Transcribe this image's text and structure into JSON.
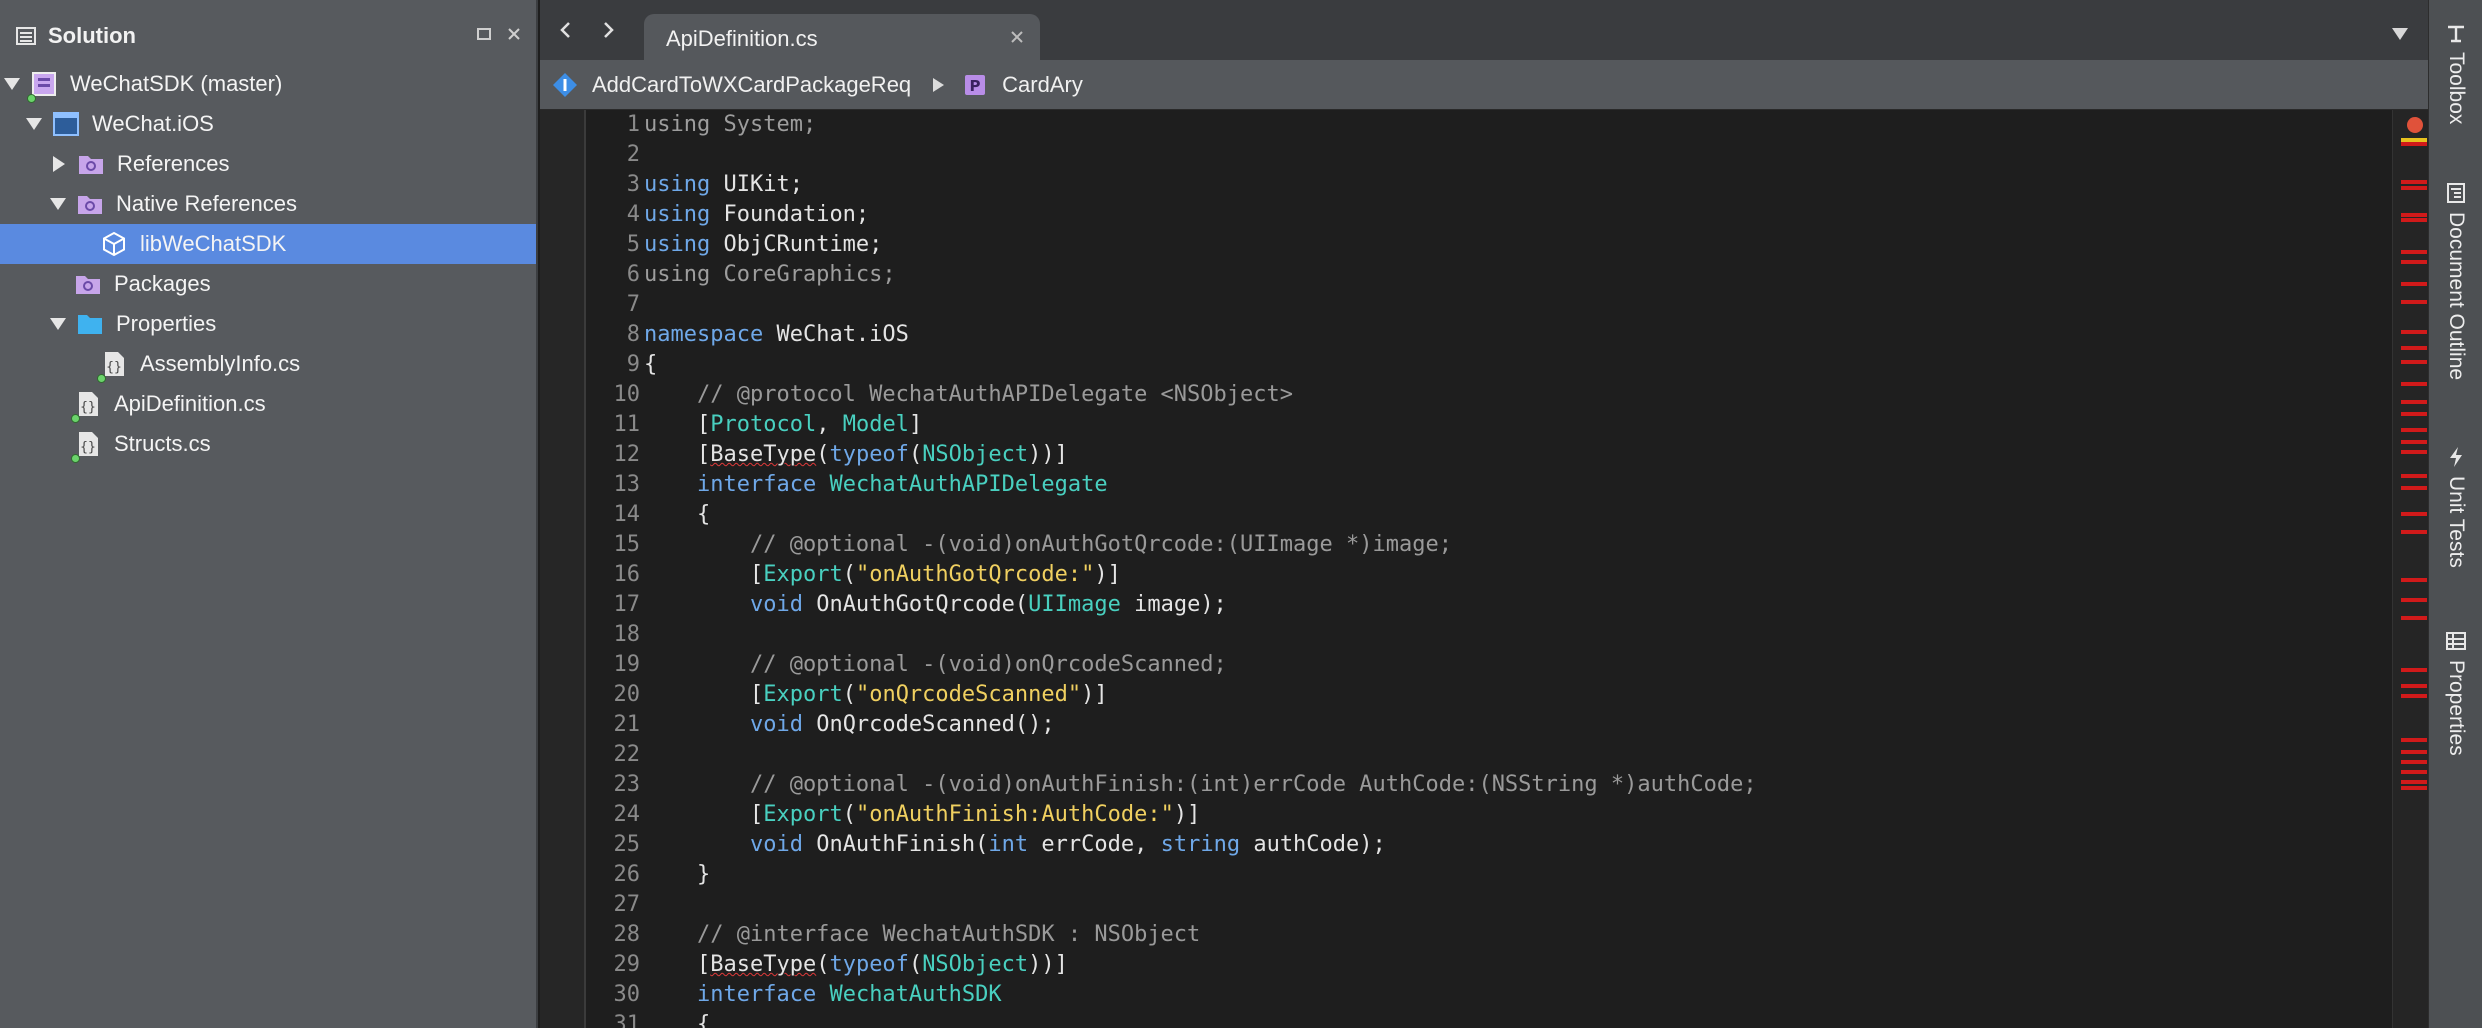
{
  "solution_pad": {
    "title": "Solution",
    "items": [
      {
        "label": "WeChatSDK (master)",
        "icon": "solution-icon"
      },
      {
        "label": "WeChat.iOS",
        "icon": "project-icon"
      },
      {
        "label": "References",
        "icon": "references-folder-icon"
      },
      {
        "label": "Native References",
        "icon": "native-references-folder-icon"
      },
      {
        "label": "libWeChatSDK",
        "icon": "library-icon"
      },
      {
        "label": "Packages",
        "icon": "packages-folder-icon"
      },
      {
        "label": "Properties",
        "icon": "folder-icon"
      },
      {
        "label": "AssemblyInfo.cs",
        "icon": "csharp-file-icon"
      },
      {
        "label": "ApiDefinition.cs",
        "icon": "csharp-file-icon"
      },
      {
        "label": "Structs.cs",
        "icon": "csharp-file-icon"
      }
    ]
  },
  "editor": {
    "active_tab": "ApiDefinition.cs",
    "breadcrumb": {
      "class_name": "AddCardToWXCardPackageReq",
      "member_name": "CardAry"
    }
  },
  "code": [
    {
      "n": "1",
      "text": "using System;"
    },
    {
      "n": "2",
      "text": ""
    },
    {
      "n": "3",
      "text": "using UIKit;"
    },
    {
      "n": "4",
      "text": "using Foundation;"
    },
    {
      "n": "5",
      "text": "using ObjCRuntime;"
    },
    {
      "n": "6",
      "text": "using CoreGraphics;"
    },
    {
      "n": "7",
      "text": ""
    },
    {
      "n": "8",
      "text": "namespace WeChat.iOS"
    },
    {
      "n": "9",
      "text": "{"
    },
    {
      "n": "10",
      "text": "    // @protocol WechatAuthAPIDelegate <NSObject>"
    },
    {
      "n": "11",
      "text": "    [Protocol, Model]"
    },
    {
      "n": "12",
      "text": "    [BaseType(typeof(NSObject))]"
    },
    {
      "n": "13",
      "text": "    interface WechatAuthAPIDelegate"
    },
    {
      "n": "14",
      "text": "    {"
    },
    {
      "n": "15",
      "text": "        // @optional -(void)onAuthGotQrcode:(UIImage *)image;"
    },
    {
      "n": "16",
      "text": "        [Export(\"onAuthGotQrcode:\")]"
    },
    {
      "n": "17",
      "text": "        void OnAuthGotQrcode(UIImage image);"
    },
    {
      "n": "18",
      "text": ""
    },
    {
      "n": "19",
      "text": "        // @optional -(void)onQrcodeScanned;"
    },
    {
      "n": "20",
      "text": "        [Export(\"onQrcodeScanned\")]"
    },
    {
      "n": "21",
      "text": "        void OnQrcodeScanned();"
    },
    {
      "n": "22",
      "text": ""
    },
    {
      "n": "23",
      "text": "        // @optional -(void)onAuthFinish:(int)errCode AuthCode:(NSString *)authCode;"
    },
    {
      "n": "24",
      "text": "        [Export(\"onAuthFinish:AuthCode:\")]"
    },
    {
      "n": "25",
      "text": "        void OnAuthFinish(int errCode, string authCode);"
    },
    {
      "n": "26",
      "text": "    }"
    },
    {
      "n": "27",
      "text": ""
    },
    {
      "n": "28",
      "text": "    // @interface WechatAuthSDK : NSObject"
    },
    {
      "n": "29",
      "text": "    [BaseType(typeof(NSObject))]"
    },
    {
      "n": "30",
      "text": "    interface WechatAuthSDK"
    },
    {
      "n": "31",
      "text": "    {"
    }
  ],
  "dock": {
    "toolbox": "Toolbox",
    "document_outline": "Document Outline",
    "unit_tests": "Unit Tests",
    "properties": "Properties"
  },
  "colors": {
    "keyword": "#6fa8e8",
    "type": "#49d0c0",
    "string": "#f0d060",
    "comment": "#9a9a9a",
    "selection": "#5a8ae0",
    "error_marker": "#d11a1a"
  }
}
